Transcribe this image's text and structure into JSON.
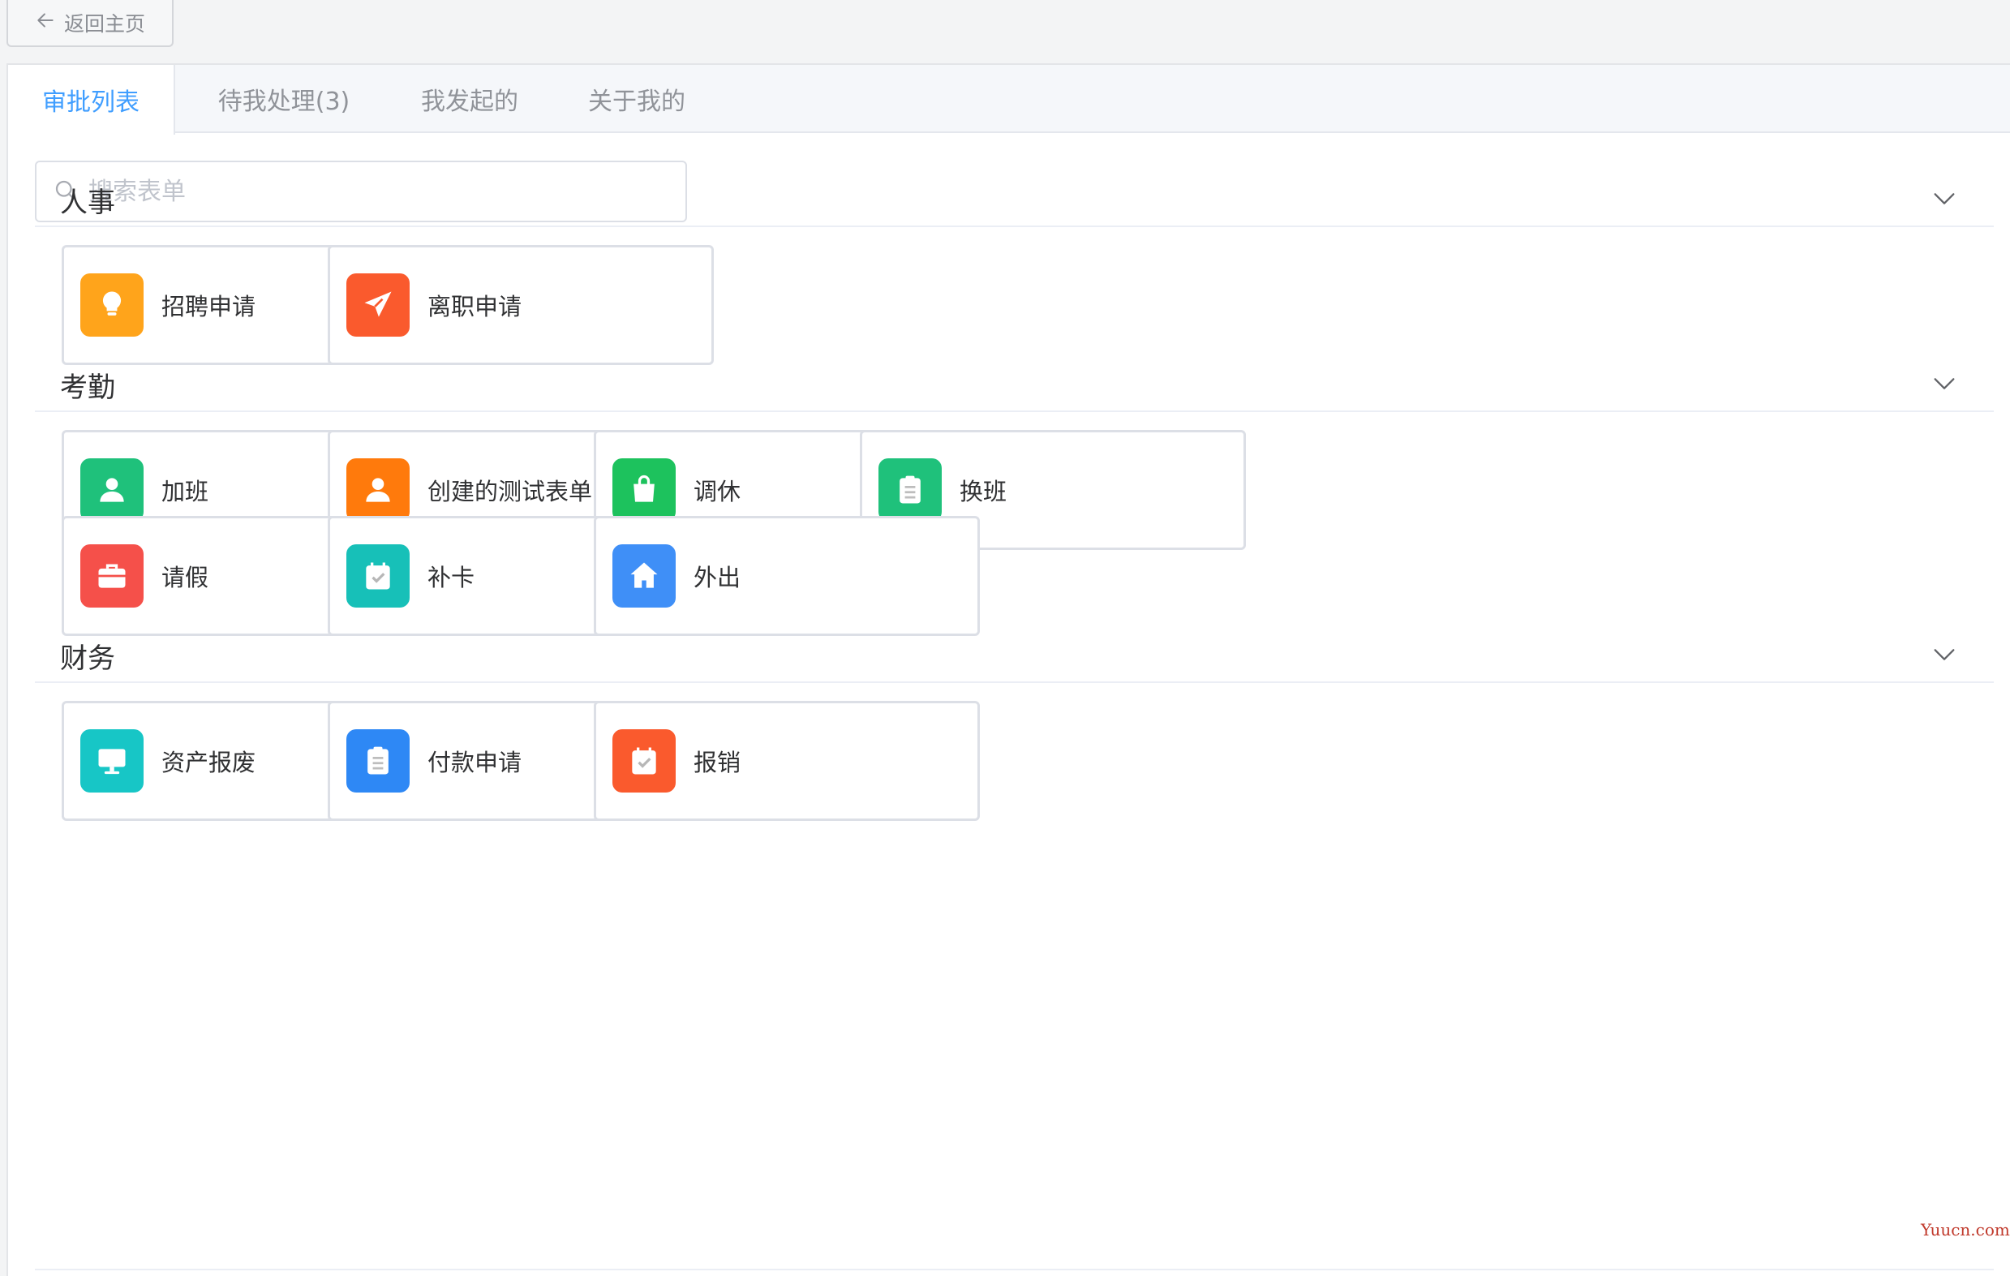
{
  "back": {
    "label": "返回主页",
    "icon": "arrow-left-icon"
  },
  "tabs": [
    {
      "label": "审批列表",
      "active": true
    },
    {
      "label": "待我处理(3)",
      "active": false
    },
    {
      "label": "我发起的",
      "active": false
    },
    {
      "label": "关于我的",
      "active": false
    }
  ],
  "search": {
    "placeholder": "搜索表单",
    "value": ""
  },
  "groups": [
    {
      "title": "人事",
      "items": [
        {
          "label": "招聘申请",
          "icon": "lightbulb-icon",
          "color": "#ffa41b"
        },
        {
          "label": "离职申请",
          "icon": "paper-plane-icon",
          "color": "#fa5a2d"
        }
      ]
    },
    {
      "title": "考勤",
      "items": [
        {
          "label": "加班",
          "icon": "user-icon",
          "color": "#1fc17b"
        },
        {
          "label": "创建的测试表单",
          "icon": "user-icon",
          "color": "#ff7a0c"
        },
        {
          "label": "调休",
          "icon": "shopping-bag-icon",
          "color": "#1dc25d"
        },
        {
          "label": "换班",
          "icon": "clipboard-icon",
          "color": "#1fc17b"
        },
        {
          "label": "请假",
          "icon": "briefcase-icon",
          "color": "#f5504a"
        },
        {
          "label": "补卡",
          "icon": "calendar-check-icon",
          "color": "#17c0b8"
        },
        {
          "label": "外出",
          "icon": "home-icon",
          "color": "#3f8ff7"
        }
      ]
    },
    {
      "title": "财务",
      "items": [
        {
          "label": "资产报废",
          "icon": "monitor-icon",
          "color": "#17c6c6"
        },
        {
          "label": "付款申请",
          "icon": "clipboard-icon",
          "color": "#2e88f5"
        },
        {
          "label": "报销",
          "icon": "calendar-check-icon",
          "color": "#fa5a2d"
        }
      ]
    }
  ],
  "watermark": "Yuucn.com"
}
